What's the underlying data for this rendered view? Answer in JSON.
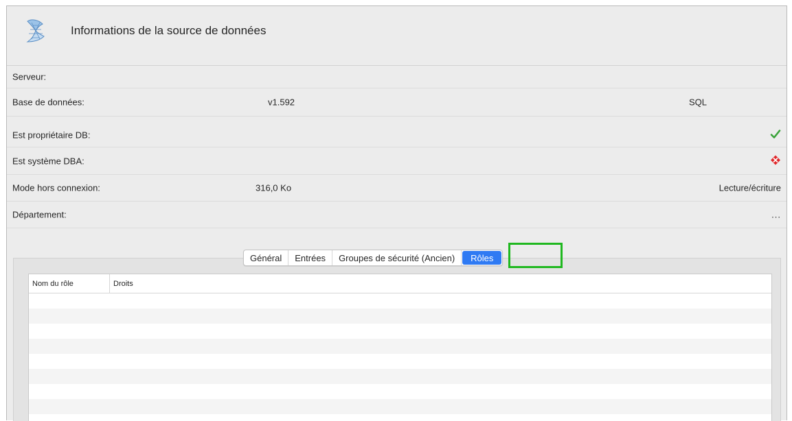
{
  "header": {
    "title": "Informations de la source de données",
    "logo_icon": "sql-server-icon"
  },
  "info": {
    "server": {
      "label": "Serveur:"
    },
    "database": {
      "label": "Base de données:",
      "version": "v1.592",
      "type": "SQL"
    },
    "db_owner": {
      "label": "Est propriétaire DB:",
      "status_icon": "check-icon",
      "status": true
    },
    "sysadmin": {
      "label": "Est système DBA:",
      "status_icon": "error-diamond-icon",
      "status": false
    },
    "offline_mode": {
      "label": "Mode hors connexion:",
      "size": "316,0 Ko",
      "access": "Lecture/écriture"
    },
    "department": {
      "label": "Département:",
      "more": "..."
    }
  },
  "tabs": [
    {
      "label": "Général",
      "active": false
    },
    {
      "label": "Entrées",
      "active": false
    },
    {
      "label": "Groupes de sécurité (Ancien)",
      "active": false
    },
    {
      "label": "Rôles",
      "active": true
    }
  ],
  "roles_table": {
    "columns": [
      "Nom du rôle",
      "Droits"
    ],
    "rows": []
  },
  "colors": {
    "accent": "#2f7af3",
    "highlight": "#1fb81f",
    "check": "#3aa33a",
    "error": "#e0282b"
  }
}
